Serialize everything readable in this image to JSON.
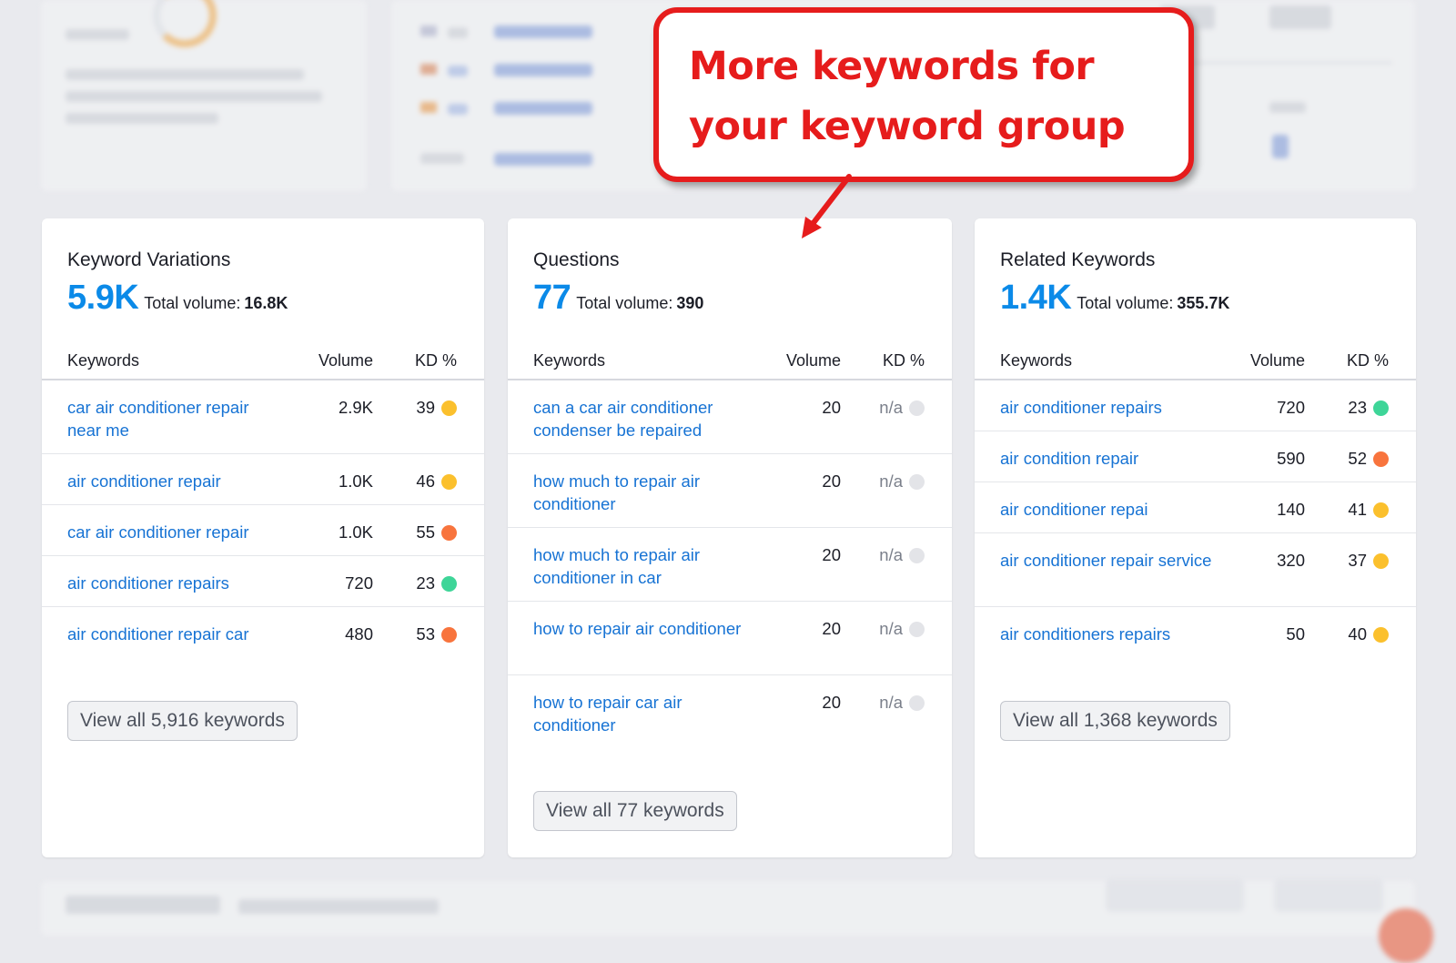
{
  "callout": {
    "text": "More keywords for your keyword group"
  },
  "colors": {
    "accent_number": "#0b8ae8",
    "link": "#1773d4",
    "callout_red": "#e61c1c",
    "dot_yellow": "#fbc02d",
    "dot_orange": "#f8743d",
    "dot_green": "#3ed598",
    "dot_gray": "#e3e4e8"
  },
  "cards": [
    {
      "title": "Keyword Variations",
      "count": "5.9K",
      "total_label": "Total volume:",
      "total_value": "16.8K",
      "columns": {
        "keywords": "Keywords",
        "volume": "Volume",
        "kd": "KD %"
      },
      "rows": [
        {
          "keyword": "car air conditioner repair near me",
          "volume": "2.9K",
          "kd": "39",
          "dot": "yellow"
        },
        {
          "keyword": "air conditioner repair",
          "volume": "1.0K",
          "kd": "46",
          "dot": "yellow"
        },
        {
          "keyword": "car air conditioner repair",
          "volume": "1.0K",
          "kd": "55",
          "dot": "orange"
        },
        {
          "keyword": "air conditioner repairs",
          "volume": "720",
          "kd": "23",
          "dot": "green"
        },
        {
          "keyword": "air conditioner repair car",
          "volume": "480",
          "kd": "53",
          "dot": "orange"
        }
      ],
      "button": "View all 5,916 keywords"
    },
    {
      "title": "Questions",
      "count": "77",
      "total_label": "Total volume:",
      "total_value": "390",
      "columns": {
        "keywords": "Keywords",
        "volume": "Volume",
        "kd": "KD %"
      },
      "rows": [
        {
          "keyword": "can a car air conditioner condenser be repaired",
          "volume": "20",
          "kd": "n/a",
          "dot": "gray"
        },
        {
          "keyword": "how much to repair air conditioner",
          "volume": "20",
          "kd": "n/a",
          "dot": "gray"
        },
        {
          "keyword": "how much to repair air conditioner in car",
          "volume": "20",
          "kd": "n/a",
          "dot": "gray"
        },
        {
          "keyword": "how to repair air conditioner",
          "volume": "20",
          "kd": "n/a",
          "dot": "gray"
        },
        {
          "keyword": "how to repair car air conditioner",
          "volume": "20",
          "kd": "n/a",
          "dot": "gray"
        }
      ],
      "button": "View all 77 keywords"
    },
    {
      "title": "Related Keywords",
      "count": "1.4K",
      "total_label": "Total volume:",
      "total_value": "355.7K",
      "columns": {
        "keywords": "Keywords",
        "volume": "Volume",
        "kd": "KD %"
      },
      "rows": [
        {
          "keyword": "air conditioner repairs",
          "volume": "720",
          "kd": "23",
          "dot": "green"
        },
        {
          "keyword": "air condition repair",
          "volume": "590",
          "kd": "52",
          "dot": "orange"
        },
        {
          "keyword": "air conditioner repai",
          "volume": "140",
          "kd": "41",
          "dot": "yellow"
        },
        {
          "keyword": "air conditioner repair service",
          "volume": "320",
          "kd": "37",
          "dot": "yellow"
        },
        {
          "keyword": "air conditioners repairs",
          "volume": "50",
          "kd": "40",
          "dot": "yellow"
        }
      ],
      "button": "View all 1,368 keywords"
    }
  ]
}
